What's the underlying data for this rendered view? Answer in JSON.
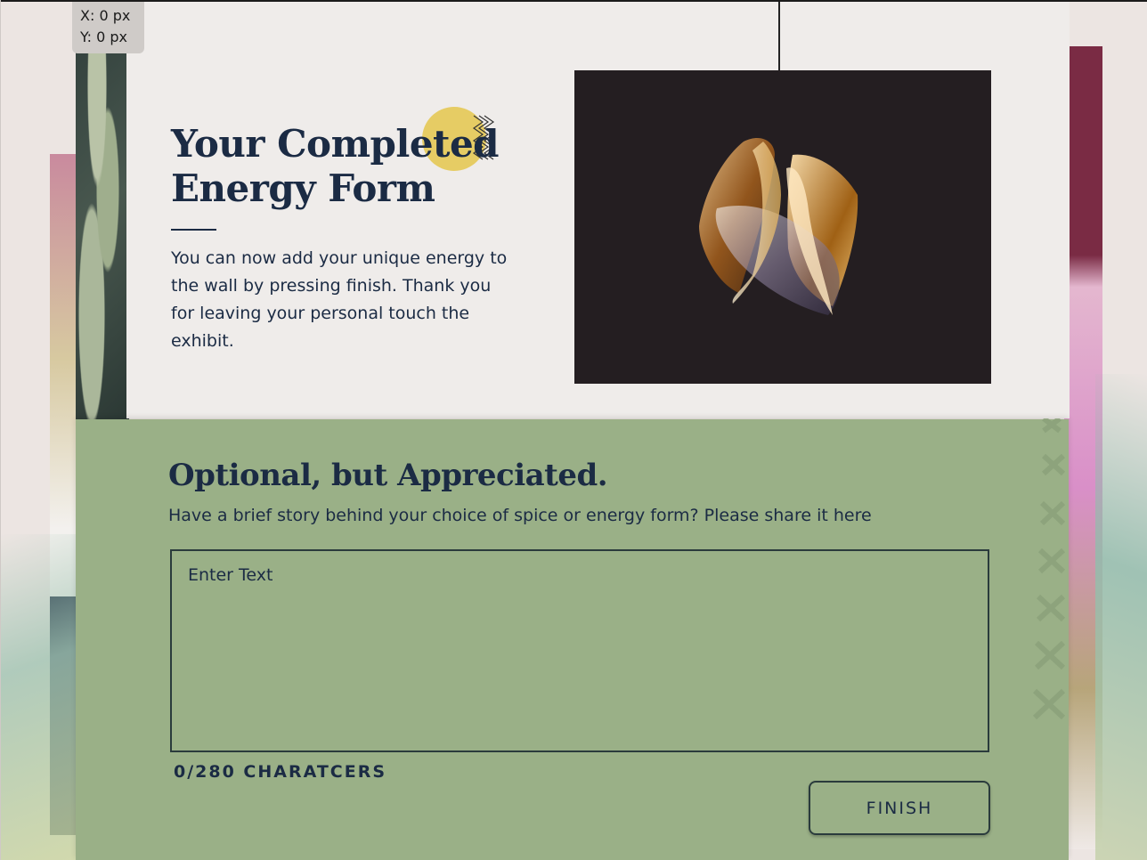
{
  "coords": {
    "x": "X: 0 px",
    "y": "Y: 0 px"
  },
  "top": {
    "title": "Your Completed Energy Form",
    "description": "You can now add your unique energy to the wall by pressing finish. Thank you for leaving your personal touch the exhibit."
  },
  "optional": {
    "title": "Optional, but Appreciated.",
    "description": "Have a brief story behind your choice of spice or energy form? Please share it here",
    "placeholder": "Enter Text",
    "char_count": "0/280 CHARATCERS",
    "finish_label": "FINISH"
  },
  "colors": {
    "navy": "#1b2b44",
    "green_panel": "#9ab087",
    "card": "#efecea",
    "accent_yellow": "#e6cc64",
    "artwork_bg": "#241e21"
  },
  "icons": [
    "zigzag-decoration-icon",
    "energy-form-image",
    "x-pattern-decoration-icon"
  ]
}
